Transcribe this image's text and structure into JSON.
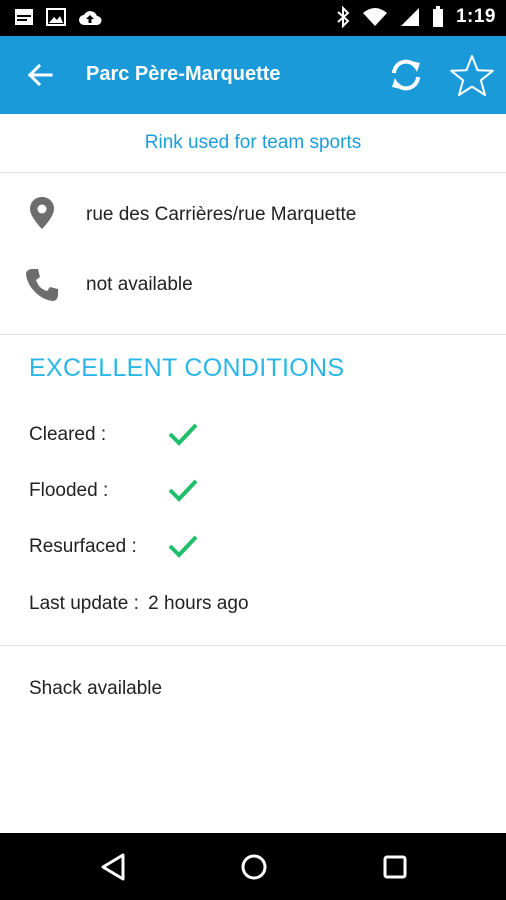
{
  "status_bar": {
    "time": "1:19",
    "left_icons": [
      "notification-icon",
      "image-icon",
      "cloud-upload-icon"
    ],
    "right_icons": [
      "bluetooth-icon",
      "wifi-icon",
      "signal-icon",
      "battery-icon"
    ]
  },
  "app_bar": {
    "title": "Parc Père-Marquette",
    "color": "#1a9ad9",
    "back_icon": "arrow-back-icon",
    "refresh_icon": "refresh-icon",
    "favorite_icon": "star-outline-icon"
  },
  "rink": {
    "type_description": "Rink used for team sports",
    "address": "rue des Carrières/rue Marquette",
    "phone": "not available",
    "address_icon": "location-pin-icon",
    "phone_icon": "phone-icon"
  },
  "conditions": {
    "title": "EXCELLENT CONDITIONS",
    "title_color": "#2ab6e6",
    "check_color": "#1fbf6a",
    "items": [
      {
        "label": "Cleared :",
        "checked": true
      },
      {
        "label": "Flooded :",
        "checked": true
      },
      {
        "label": "Resurfaced :",
        "checked": true
      }
    ],
    "last_update_label": "Last update :",
    "last_update_value": "2 hours ago"
  },
  "amenities": {
    "shack": "Shack available"
  },
  "nav_bar": {
    "buttons": [
      "back-triangle-icon",
      "home-circle-icon",
      "recents-square-icon"
    ]
  }
}
